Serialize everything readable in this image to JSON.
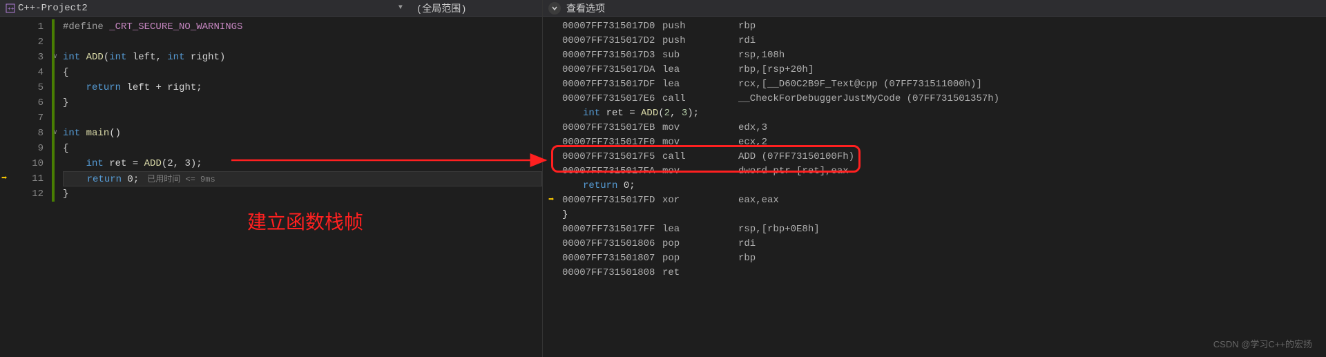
{
  "header": {
    "project_title": "C++-Project2",
    "dropdown_icon": "▼",
    "scope_label": "(全局范围)"
  },
  "right_header": {
    "view_options": "查看选项"
  },
  "line_numbers": [
    "1",
    "2",
    "3",
    "4",
    "5",
    "6",
    "7",
    "8",
    "9",
    "10",
    "11",
    "12"
  ],
  "code": {
    "l1_define": "#define",
    "l1_macro": "_CRT_SECURE_NO_WARNINGS",
    "l3_int": "int",
    "l3_add": "ADD",
    "l3_params_int1": "int",
    "l3_params_left": " left, ",
    "l3_params_int2": "int",
    "l3_params_right": " right)",
    "l4_brace": "{",
    "l5_return": "return",
    "l5_expr": " left + right;",
    "l6_brace": "}",
    "l8_int": "int",
    "l8_main": "main",
    "l8_parens": "()",
    "l9_brace": "{",
    "l10_int": "int",
    "l10_ret": " ret = ",
    "l10_add": "ADD",
    "l10_args": "(2, 3);",
    "l11_return": "return",
    "l11_zero": " 0;",
    "l11_hint": "已用时间 <= 9ms",
    "l12_brace": "}"
  },
  "disasm": {
    "rows": [
      {
        "addr": "00007FF7315017D0",
        "mn": "push",
        "op": "rbp"
      },
      {
        "addr": "00007FF7315017D2",
        "mn": "push",
        "op": "rdi"
      },
      {
        "addr": "00007FF7315017D3",
        "mn": "sub",
        "op": "rsp,108h"
      },
      {
        "addr": "00007FF7315017DA",
        "mn": "lea",
        "op": "rbp,[rsp+20h]"
      },
      {
        "addr": "00007FF7315017DF",
        "mn": "lea",
        "op": "rcx,[__D60C2B9F_Text@cpp (07FF731511000h)]"
      },
      {
        "addr": "00007FF7315017E6",
        "mn": "call",
        "op": "__CheckForDebuggerJustMyCode (07FF731501357h)"
      }
    ],
    "src1_int": "int",
    "src1_text": " ret = ",
    "src1_fn": "ADD",
    "src1_args": "(",
    "src1_n1": "2",
    "src1_c": ", ",
    "src1_n2": "3",
    "src1_end": ");",
    "rows2": [
      {
        "addr": "00007FF7315017EB",
        "mn": "mov",
        "op": "edx,3"
      },
      {
        "addr": "00007FF7315017F0",
        "mn": "mov",
        "op": "ecx,2"
      },
      {
        "addr": "00007FF7315017F5",
        "mn": "call",
        "op": "ADD (07FF73150100Fh)"
      },
      {
        "addr": "00007FF7315017FA",
        "mn": "mov",
        "op": "dword ptr [ret],eax"
      }
    ],
    "src2_ret": "return",
    "src2_zero": " 0",
    "src2_brace": "}",
    "rows3": [
      {
        "addr": "00007FF7315017FD",
        "mn": "xor",
        "op": "eax,eax"
      }
    ],
    "rows4": [
      {
        "addr": "00007FF7315017FF",
        "mn": "lea",
        "op": "rsp,[rbp+0E8h]"
      },
      {
        "addr": "00007FF731501806",
        "mn": "pop",
        "op": "rdi"
      },
      {
        "addr": "00007FF731501807",
        "mn": "pop",
        "op": "rbp"
      },
      {
        "addr": "00007FF731501808",
        "mn": "ret",
        "op": ""
      }
    ]
  },
  "annotation": {
    "text": "建立函数栈帧"
  },
  "watermark": "CSDN @学习C++的宏扬"
}
